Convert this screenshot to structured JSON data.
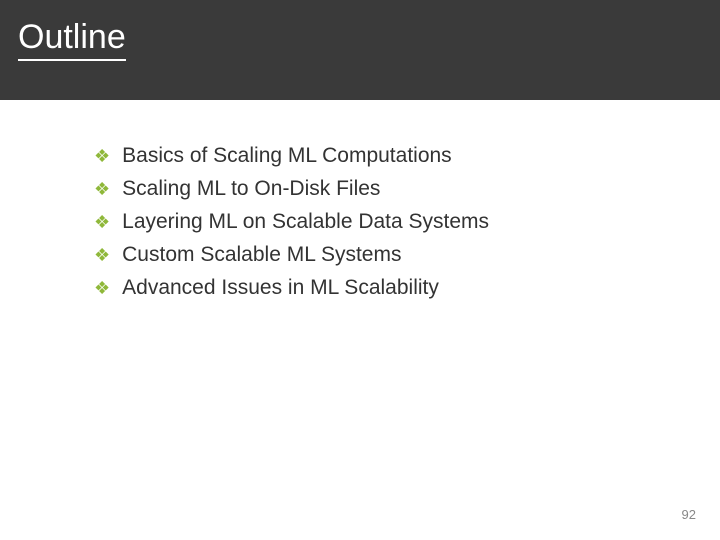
{
  "header": {
    "title": "Outline"
  },
  "outline": {
    "items": [
      {
        "text": "Basics of Scaling ML Computations"
      },
      {
        "text": "Scaling ML to On-Disk Files"
      },
      {
        "text": "Layering ML on Scalable Data Systems"
      },
      {
        "text": "Custom Scalable ML Systems"
      },
      {
        "text": "Advanced Issues in ML Scalability"
      }
    ]
  },
  "footer": {
    "page_number": "92"
  },
  "style": {
    "bullet_glyph": "❖"
  }
}
